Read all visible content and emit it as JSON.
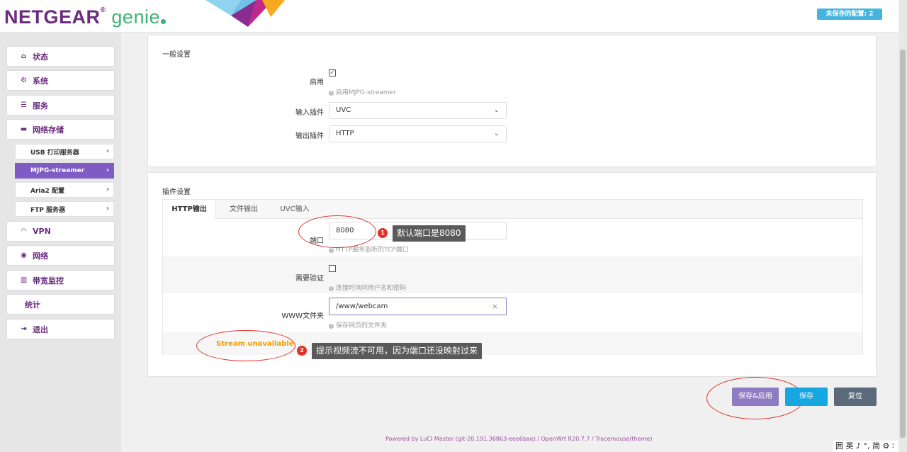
{
  "header": {
    "brand": "NETGEAR",
    "product": "genie",
    "unsaved_label": "未保存的配置: 2"
  },
  "sidebar": {
    "items": [
      {
        "label": "状态",
        "icon": "home-icon"
      },
      {
        "label": "系统",
        "icon": "gears-icon"
      },
      {
        "label": "服务",
        "icon": "list-icon"
      },
      {
        "label": "网络存储",
        "icon": "drive-icon"
      }
    ],
    "subitems": [
      {
        "label": "USB 打印服务器"
      },
      {
        "label": "MJPG-streamer"
      },
      {
        "label": "Aria2 配置"
      },
      {
        "label": "FTP 服务器"
      }
    ],
    "items2": [
      {
        "label": "VPN",
        "icon": "gauge-icon"
      },
      {
        "label": "网络",
        "icon": "globe-icon"
      },
      {
        "label": "带宽监控",
        "icon": "bar-chart-icon"
      },
      {
        "label": "统计",
        "icon": ""
      },
      {
        "label": "退出",
        "icon": "logout-icon"
      }
    ],
    "active_subitem": "MJPG-streamer"
  },
  "general": {
    "title": "一般设置",
    "enable_label": "启用",
    "enable_checked": true,
    "enable_hint": "启用MJPG-streamer",
    "input_plugin_label": "输入插件",
    "input_plugin_value": "UVC",
    "output_plugin_label": "输出插件",
    "output_plugin_value": "HTTP"
  },
  "plugin": {
    "title": "插件设置",
    "tabs": [
      "HTTP输出",
      "文件输出",
      "UVC输入"
    ],
    "port_label": "端口",
    "port_value": "8080",
    "port_hint": "HTTP服务监听的TCP端口",
    "auth_label": "需要验证",
    "auth_checked": false,
    "auth_hint": "连接时询问用户名和密码",
    "www_label": "WWW文件夹",
    "www_value": "/www/webcam",
    "www_hint": "保存网页的文件夹",
    "stream_status": "Stream unavailable"
  },
  "annotations": {
    "note1_num": "1",
    "note1_text": "默认端口是8080",
    "note2_num": "2",
    "note2_text": "提示视频流不可用，因为端口还没映射过来"
  },
  "buttons": {
    "save_apply": "保存&应用",
    "save": "保存",
    "reset": "复位"
  },
  "footer": "Powered by LuCI Master (git-20.191.36863-eee6bae) / OpenWrt R20.7.7 / Tracemouse(theme)",
  "ime": "囲 英 ♪ °, 简 ⚙ ∶",
  "colors": {
    "brand_purple": "#6b2c7e",
    "active_sub": "#7f5bc4",
    "save_apply": "#8e7cc3",
    "save": "#16a6e0",
    "reset": "#5a6a7a",
    "warn": "#f0a000",
    "annot_red": "#d9342b"
  }
}
